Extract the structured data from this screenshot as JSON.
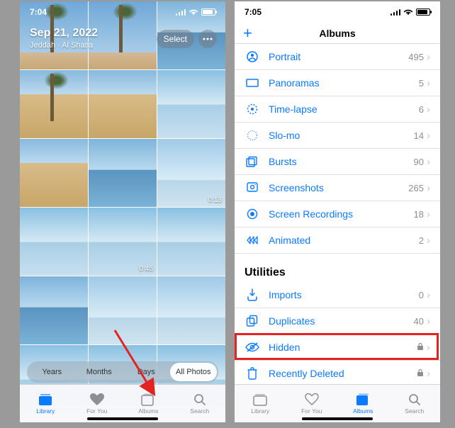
{
  "left": {
    "time": "7:04",
    "date": "Sep 21, 2022",
    "location": "Jeddah · Al Shatia",
    "select_label": "Select",
    "durations": {
      "cell6": "0:13",
      "cell8": "0:45"
    },
    "segments": [
      "Years",
      "Months",
      "Days",
      "All Photos"
    ],
    "segment_active": 3,
    "tabs": [
      {
        "id": "library",
        "label": "Library"
      },
      {
        "id": "foryou",
        "label": "For You"
      },
      {
        "id": "albums",
        "label": "Albums"
      },
      {
        "id": "search",
        "label": "Search"
      }
    ],
    "tab_active": 0
  },
  "right": {
    "time": "7:05",
    "title": "Albums",
    "media_types": [
      {
        "id": "portrait",
        "label": "Portrait",
        "count": "495"
      },
      {
        "id": "panoramas",
        "label": "Panoramas",
        "count": "5"
      },
      {
        "id": "timelapse",
        "label": "Time-lapse",
        "count": "6"
      },
      {
        "id": "slomo",
        "label": "Slo-mo",
        "count": "14"
      },
      {
        "id": "bursts",
        "label": "Bursts",
        "count": "90"
      },
      {
        "id": "screenshots",
        "label": "Screenshots",
        "count": "265"
      },
      {
        "id": "screenrec",
        "label": "Screen Recordings",
        "count": "18"
      },
      {
        "id": "animated",
        "label": "Animated",
        "count": "2"
      }
    ],
    "utilities_header": "Utilities",
    "utilities": [
      {
        "id": "imports",
        "label": "Imports",
        "count": "0",
        "locked": false
      },
      {
        "id": "duplicates",
        "label": "Duplicates",
        "count": "40",
        "locked": false
      },
      {
        "id": "hidden",
        "label": "Hidden",
        "count": "",
        "locked": true
      },
      {
        "id": "recentlydeleted",
        "label": "Recently Deleted",
        "count": "",
        "locked": true
      }
    ],
    "tabs": [
      {
        "id": "library",
        "label": "Library"
      },
      {
        "id": "foryou",
        "label": "For You"
      },
      {
        "id": "albums",
        "label": "Albums"
      },
      {
        "id": "search",
        "label": "Search"
      }
    ],
    "tab_active": 2
  }
}
